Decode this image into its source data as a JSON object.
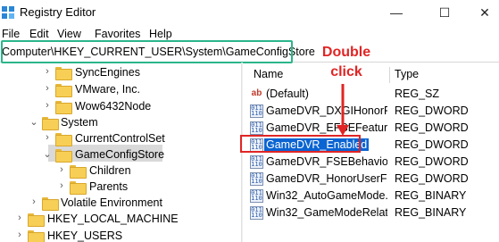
{
  "window": {
    "title": "Registry Editor",
    "minimize_glyph": "—",
    "maximize_glyph": "☐",
    "close_glyph": "✕"
  },
  "menu": [
    "File",
    "Edit",
    "View",
    "Favorites",
    "Help"
  ],
  "address": {
    "path": "Computer\\HKEY_CURRENT_USER\\System\\GameConfigStore",
    "highlight_color": "#2bb58a"
  },
  "tree": {
    "items": [
      {
        "label": "SyncEngines",
        "expander": ">"
      },
      {
        "label": "VMware, Inc.",
        "expander": ">"
      },
      {
        "label": "Wow6432Node",
        "expander": ">"
      },
      {
        "label": "System",
        "expander": "v"
      },
      {
        "label": "CurrentControlSet",
        "expander": ">"
      },
      {
        "label": "GameConfigStore",
        "expander": "v",
        "selected": true
      },
      {
        "label": "Children",
        "expander": ">"
      },
      {
        "label": "Parents",
        "expander": ">"
      },
      {
        "label": "Volatile Environment",
        "expander": ">"
      },
      {
        "label": "HKEY_LOCAL_MACHINE",
        "expander": ">"
      },
      {
        "label": "HKEY_USERS",
        "expander": ">"
      }
    ]
  },
  "values": {
    "header": {
      "name": "Name",
      "type": "Type"
    },
    "rows": [
      {
        "name": "(Default)",
        "type": "REG_SZ",
        "icon": "string-value-icon"
      },
      {
        "name": "GameDVR_DXGIHonorF...",
        "type": "REG_DWORD",
        "icon": "binary-value-icon"
      },
      {
        "name": "GameDVR_EFSEFeatureF...",
        "type": "REG_DWORD",
        "icon": "binary-value-icon"
      },
      {
        "name": "GameDVR_Enabled",
        "type": "REG_DWORD",
        "icon": "binary-value-icon",
        "selected": true
      },
      {
        "name": "GameDVR_FSEBehavior...",
        "type": "REG_DWORD",
        "icon": "binary-value-icon"
      },
      {
        "name": "GameDVR_HonorUserFS...",
        "type": "REG_DWORD",
        "icon": "binary-value-icon"
      },
      {
        "name": "Win32_AutoGameMode...",
        "type": "REG_BINARY",
        "icon": "binary-value-icon"
      },
      {
        "name": "Win32_GameModeRelat...",
        "type": "REG_BINARY",
        "icon": "binary-value-icon"
      }
    ]
  },
  "annotation": {
    "line1": "Double",
    "line2": "click",
    "color": "#e02525"
  },
  "colors": {
    "selection_blue": "#0a64d2",
    "folder_yellow": "#f7cf56",
    "accent_red": "#e02525"
  }
}
